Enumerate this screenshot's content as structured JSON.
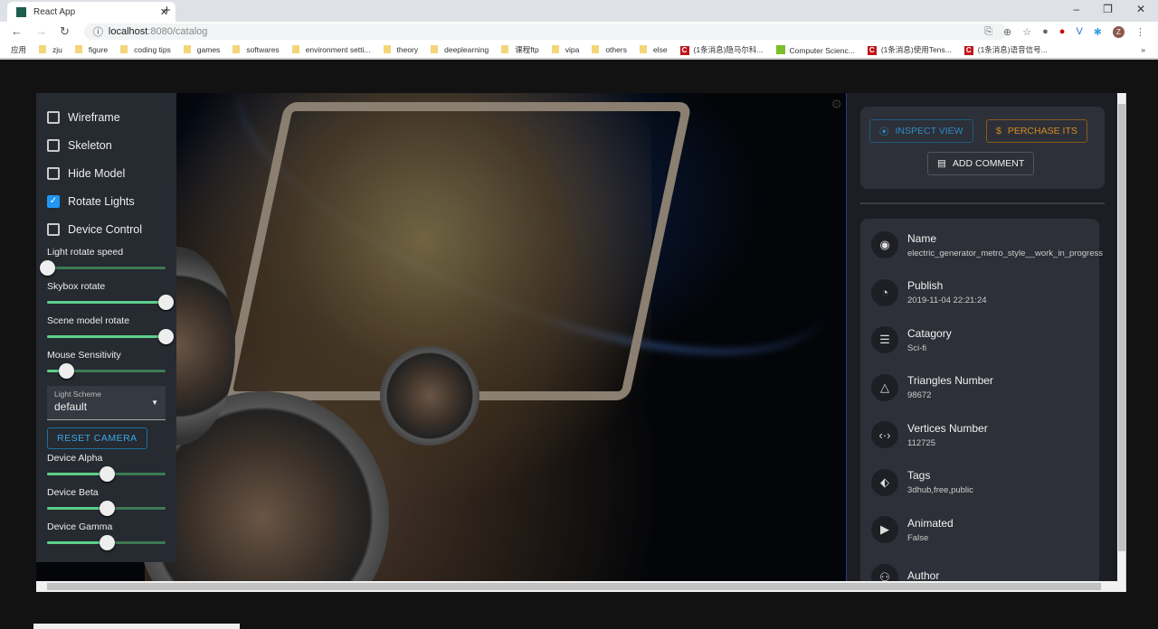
{
  "browser": {
    "tab_title": "React App",
    "url_host": "localhost",
    "url_path": ":8080/catalog",
    "bookmarks": [
      {
        "label": "应用",
        "type": "apps"
      },
      {
        "label": "zju",
        "type": "f"
      },
      {
        "label": "figure",
        "type": "f"
      },
      {
        "label": "coding tips",
        "type": "f"
      },
      {
        "label": "games",
        "type": "f"
      },
      {
        "label": "softwares",
        "type": "f"
      },
      {
        "label": "environment setti...",
        "type": "f"
      },
      {
        "label": "theory",
        "type": "f"
      },
      {
        "label": "deeplearning",
        "type": "f"
      },
      {
        "label": "课程ftp",
        "type": "f"
      },
      {
        "label": "vipa",
        "type": "f"
      },
      {
        "label": "others",
        "type": "f"
      },
      {
        "label": "else",
        "type": "f"
      },
      {
        "label": "(1条消息)隐马尔科...",
        "type": "c"
      },
      {
        "label": "Computer Scienc...",
        "type": "g"
      },
      {
        "label": "(1条消息)使用Tens...",
        "type": "c"
      },
      {
        "label": "(1条消息)语音信号...",
        "type": "c"
      }
    ],
    "avatar": "Z"
  },
  "controls": {
    "checkboxes": [
      {
        "label": "Wireframe",
        "checked": false
      },
      {
        "label": "Skeleton",
        "checked": false
      },
      {
        "label": "Hide Model",
        "checked": false
      },
      {
        "label": "Rotate Lights",
        "checked": true
      },
      {
        "label": "Device Control",
        "checked": false
      }
    ],
    "sliders1": [
      {
        "label": "Light rotate speed",
        "value": 0
      },
      {
        "label": "Skybox rotate",
        "value": 1
      },
      {
        "label": "Scene model rotate",
        "value": 1
      },
      {
        "label": "Mouse Sensitivity",
        "value": 0.16
      }
    ],
    "light_scheme": {
      "label": "Light Scheme",
      "value": "default"
    },
    "reset_camera": "RESET CAMERA",
    "sliders2": [
      {
        "label": "Device Alpha",
        "value": 0.5
      },
      {
        "label": "Device Beta",
        "value": 0.5
      },
      {
        "label": "Device Gamma",
        "value": 0.5
      }
    ]
  },
  "actions": {
    "inspect": "INSPECT VIEW",
    "purchase": "PERCHASE ITS",
    "comment": "ADD COMMENT"
  },
  "info": [
    {
      "title": "Name",
      "value": "electric_generator_metro_style__work_in_progress",
      "icon": "fingerprint"
    },
    {
      "title": "Publish",
      "value": "2019-11-04 22:21:24",
      "icon": "clock"
    },
    {
      "title": "Catagory",
      "value": "Sci-fi",
      "icon": "list"
    },
    {
      "title": "Triangles Number",
      "value": "98672",
      "icon": "triangle"
    },
    {
      "title": "Vertices Number",
      "value": "112725",
      "icon": "code"
    },
    {
      "title": "Tags",
      "value": "3dhub,free,public",
      "icon": "tag"
    },
    {
      "title": "Animated",
      "value": "False",
      "icon": "play"
    },
    {
      "title": "Author",
      "value": "",
      "icon": "people"
    }
  ]
}
